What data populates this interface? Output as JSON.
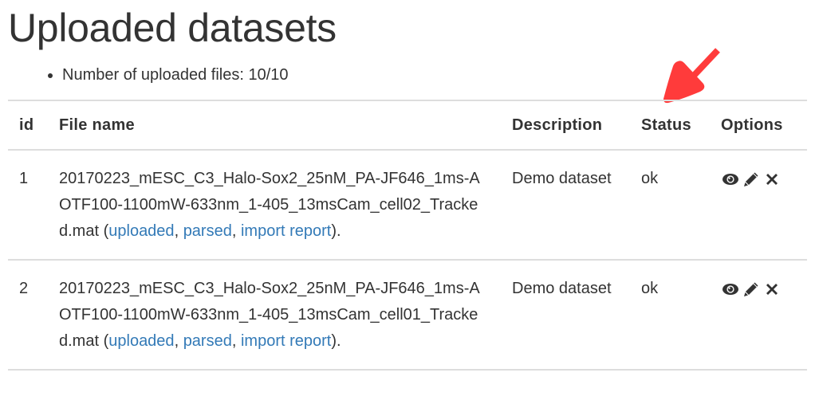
{
  "page": {
    "title": "Uploaded datasets",
    "summary_items": [
      "Number of uploaded files: 10/10"
    ]
  },
  "table": {
    "headers": {
      "id": "id",
      "file_name": "File name",
      "description": "Description",
      "status": "Status",
      "options": "Options"
    },
    "rows": [
      {
        "id": "1",
        "file_name": "20170223_mESC_C3_Halo-Sox2_25nM_PA-JF646_1ms-AOTF100-1100mW-633nm_1-405_13msCam_cell02_Tracked.mat",
        "open_paren": " (",
        "link_uploaded": "uploaded",
        "sep1": ", ",
        "link_parsed": "parsed",
        "sep2": ", ",
        "link_import_report": "import report",
        "close_paren": ").",
        "description": "Demo dataset",
        "status": "ok",
        "options": [
          "view-icon",
          "edit-icon",
          "delete-icon"
        ]
      },
      {
        "id": "2",
        "file_name": "20170223_mESC_C3_Halo-Sox2_25nM_PA-JF646_1ms-AOTF100-1100mW-633nm_1-405_13msCam_cell01_Tracked.mat",
        "open_paren": " (",
        "link_uploaded": "uploaded",
        "sep1": ", ",
        "link_parsed": "parsed",
        "sep2": ", ",
        "link_import_report": "import report",
        "close_paren": ").",
        "description": "Demo dataset",
        "status": "ok",
        "options": [
          "view-icon",
          "edit-icon",
          "delete-icon"
        ]
      }
    ]
  },
  "annotation": {
    "type": "arrow",
    "points_to": "Status",
    "color": "#ff3b3b"
  },
  "colors": {
    "text": "#333333",
    "link": "#337ab7",
    "border": "#dddddd"
  }
}
